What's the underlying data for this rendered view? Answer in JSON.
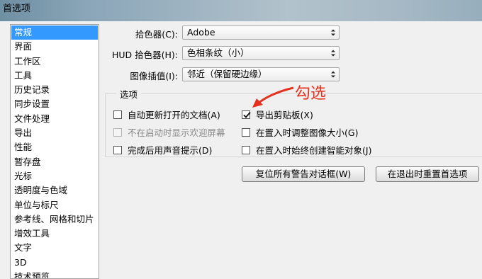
{
  "window": {
    "title": "首选项"
  },
  "sidebar": {
    "items": [
      "常规",
      "界面",
      "工作区",
      "工具",
      "历史记录",
      "同步设置",
      "文件处理",
      "导出",
      "性能",
      "暂存盘",
      "光标",
      "透明度与色域",
      "单位与标尺",
      "参考线、网格和切片",
      "增效工具",
      "文字",
      "3D",
      "技术预览"
    ]
  },
  "general": {
    "color_picker_label": "拾色器(C):",
    "color_picker_value": "Adobe",
    "hud_picker_label": "HUD 拾色器(H):",
    "hud_picker_value": "色相条纹（小）",
    "interpolation_label": "图像插值(I):",
    "interpolation_value": "邻近（保留硬边缘）"
  },
  "options": {
    "group_label": "选项",
    "auto_update": {
      "label": "自动更新打开的文档(A)",
      "checked": false
    },
    "hide_welcome": {
      "label": "不在启动时显示欢迎屏幕",
      "checked": false,
      "disabled": true
    },
    "beep": {
      "label": "完成后用声音提示(D)",
      "checked": false
    },
    "export_clipboard": {
      "label": "导出剪贴板(X)",
      "checked": true
    },
    "resize_on_place": {
      "label": "在置入时调整图像大小(G)",
      "checked": false
    },
    "smart_object": {
      "label": "在置入时始终创建智能对象(J)",
      "checked": false
    }
  },
  "buttons": {
    "reset_warnings": "复位所有警告对话框(W)",
    "reset_prefs": "在退出时重置首选项"
  },
  "annotation": {
    "text": "勾选",
    "color": "#e5301e"
  },
  "colors": {
    "selection": "#3399ff"
  }
}
